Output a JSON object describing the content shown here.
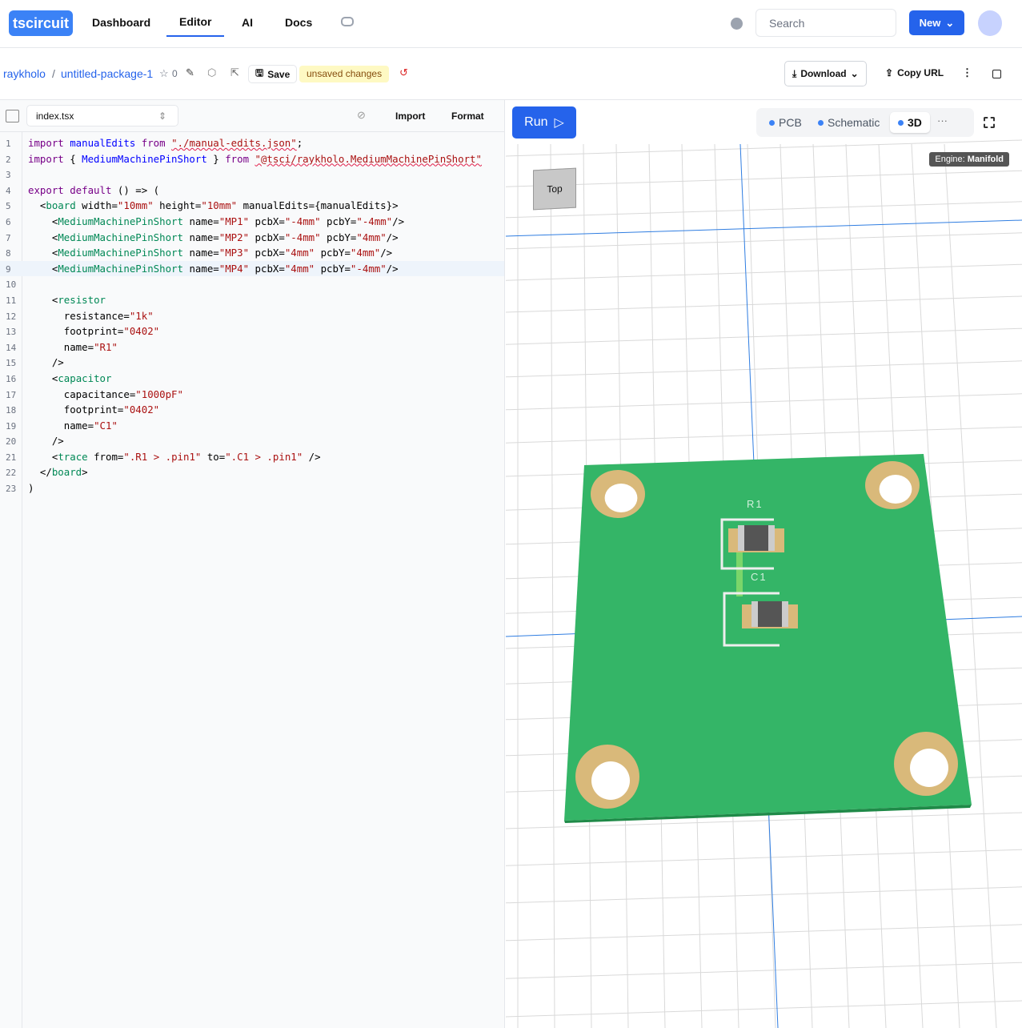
{
  "nav": {
    "logo": "tscircuit",
    "items": [
      "Dashboard",
      "Editor",
      "AI",
      "Docs"
    ],
    "search_placeholder": "Search",
    "new_label": "New"
  },
  "pkg": {
    "owner": "raykholo",
    "sep": "/",
    "name": "untitled-package-1",
    "stars": "0",
    "save": "Save",
    "unsaved": "unsaved changes",
    "download": "Download",
    "copy_url": "Copy URL"
  },
  "editor": {
    "file": "index.tsx",
    "import": "Import",
    "format": "Format",
    "lines": [
      [
        [
          "k",
          "import "
        ],
        [
          "v",
          "manualEdits "
        ],
        [
          "k",
          "from "
        ],
        [
          "s sq",
          "\"./manual-edits.json\""
        ],
        [
          "n",
          ";"
        ]
      ],
      [
        [
          "k",
          "import "
        ],
        [
          "n",
          "{ "
        ],
        [
          "v",
          "MediumMachinePinShort "
        ],
        [
          "n",
          "} "
        ],
        [
          "k",
          "from "
        ],
        [
          "s sq",
          "\"@tsci/raykholo.MediumMachinePinShort\""
        ]
      ],
      [],
      [
        [
          "k",
          "export "
        ],
        [
          "k",
          "default "
        ],
        [
          "n",
          "() => ("
        ]
      ],
      [
        [
          "n",
          "  <"
        ],
        [
          "g",
          "board "
        ],
        [
          "n",
          "width="
        ],
        [
          "s",
          "\"10mm\""
        ],
        [
          "n",
          " height="
        ],
        [
          "s",
          "\"10mm\""
        ],
        [
          "n",
          " manualEdits={manualEdits}>"
        ]
      ],
      [
        [
          "n",
          "    <"
        ],
        [
          "g",
          "MediumMachinePinShort "
        ],
        [
          "n",
          "name="
        ],
        [
          "s",
          "\"MP1\""
        ],
        [
          "n",
          " pcbX="
        ],
        [
          "s",
          "\"-4mm\""
        ],
        [
          "n",
          " pcbY="
        ],
        [
          "s",
          "\"-4mm\""
        ],
        [
          "n",
          "/>"
        ]
      ],
      [
        [
          "n",
          "    <"
        ],
        [
          "g",
          "MediumMachinePinShort "
        ],
        [
          "n",
          "name="
        ],
        [
          "s",
          "\"MP2\""
        ],
        [
          "n",
          " pcbX="
        ],
        [
          "s",
          "\"-4mm\""
        ],
        [
          "n",
          " pcbY="
        ],
        [
          "s",
          "\"4mm\""
        ],
        [
          "n",
          "/>"
        ]
      ],
      [
        [
          "n",
          "    <"
        ],
        [
          "g",
          "MediumMachinePinShort "
        ],
        [
          "n",
          "name="
        ],
        [
          "s",
          "\"MP3\""
        ],
        [
          "n",
          " pcbX="
        ],
        [
          "s",
          "\"4mm\""
        ],
        [
          "n",
          " pcbY="
        ],
        [
          "s",
          "\"4mm\""
        ],
        [
          "n",
          "/>"
        ]
      ],
      [
        [
          "n",
          "    <"
        ],
        [
          "g",
          "MediumMachinePinShort "
        ],
        [
          "n",
          "name="
        ],
        [
          "s",
          "\"MP4\""
        ],
        [
          "n",
          " pcbX="
        ],
        [
          "s",
          "\"4mm\""
        ],
        [
          "n",
          " pcbY="
        ],
        [
          "s",
          "\"-4mm\""
        ],
        [
          "n",
          "/>"
        ]
      ],
      [],
      [
        [
          "n",
          "    <"
        ],
        [
          "g",
          "resistor"
        ]
      ],
      [
        [
          "n",
          "      resistance="
        ],
        [
          "s",
          "\"1k\""
        ]
      ],
      [
        [
          "n",
          "      footprint="
        ],
        [
          "s",
          "\"0402\""
        ]
      ],
      [
        [
          "n",
          "      name="
        ],
        [
          "s",
          "\"R1\""
        ]
      ],
      [
        [
          "n",
          "    />"
        ]
      ],
      [
        [
          "n",
          "    <"
        ],
        [
          "g",
          "capacitor"
        ]
      ],
      [
        [
          "n",
          "      capacitance="
        ],
        [
          "s",
          "\"1000pF\""
        ]
      ],
      [
        [
          "n",
          "      footprint="
        ],
        [
          "s",
          "\"0402\""
        ]
      ],
      [
        [
          "n",
          "      name="
        ],
        [
          "s",
          "\"C1\""
        ]
      ],
      [
        [
          "n",
          "    />"
        ]
      ],
      [
        [
          "n",
          "    <"
        ],
        [
          "g",
          "trace "
        ],
        [
          "n",
          "from="
        ],
        [
          "s",
          "\".R1 > .pin1\""
        ],
        [
          "n",
          " to="
        ],
        [
          "s",
          "\".C1 > .pin1\""
        ],
        [
          "n",
          " />"
        ]
      ],
      [
        [
          "n",
          "  </"
        ],
        [
          "g",
          "board"
        ],
        [
          "n",
          ">"
        ]
      ],
      [
        [
          "n",
          ")"
        ]
      ]
    ]
  },
  "viewer": {
    "run": "Run",
    "tabs": [
      "PCB",
      "Schematic",
      "3D"
    ],
    "active_tab": "3D",
    "more": "···",
    "engine_label": "Engine:",
    "engine": "Manifold",
    "cube_face": "Top",
    "r1": "R1",
    "c1": "C1"
  },
  "colors": {
    "accent": "#2563eb",
    "board": "#34b567",
    "pad": "#d9b97a"
  }
}
